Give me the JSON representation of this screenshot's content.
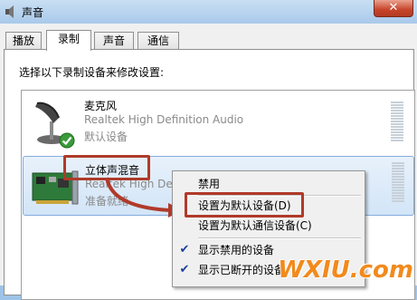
{
  "window": {
    "title": "声音",
    "close_label": "✕"
  },
  "tabs": [
    {
      "label": "播放",
      "active": false
    },
    {
      "label": "录制",
      "active": true
    },
    {
      "label": "声音",
      "active": false
    },
    {
      "label": "通信",
      "active": false
    }
  ],
  "instruction": "选择以下录制设备来修改设置:",
  "devices": [
    {
      "name": "麦克风",
      "description": "Realtek High Definition Audio",
      "status": "默认设备",
      "icon": "microphone-icon",
      "badge": "default-check-icon"
    },
    {
      "name": "立体声混音",
      "description": "Realtek High Definition Audio",
      "status": "准备就绪",
      "icon": "sound-card-icon"
    }
  ],
  "context_menu": {
    "items": [
      {
        "label": "禁用",
        "checked": false
      },
      {
        "label": "设置为默认设备(D)",
        "checked": false,
        "highlighted": true
      },
      {
        "label": "设置为默认通信设备(C)",
        "checked": false
      },
      {
        "label": "显示禁用的设备",
        "checked": true
      },
      {
        "label": "显示已断开的设备",
        "checked": true
      }
    ]
  },
  "watermark": "WXIU.com",
  "colors": {
    "highlight": "#b03a2a",
    "selection": "#d2e5f8",
    "watermark": "#f28a1c"
  }
}
